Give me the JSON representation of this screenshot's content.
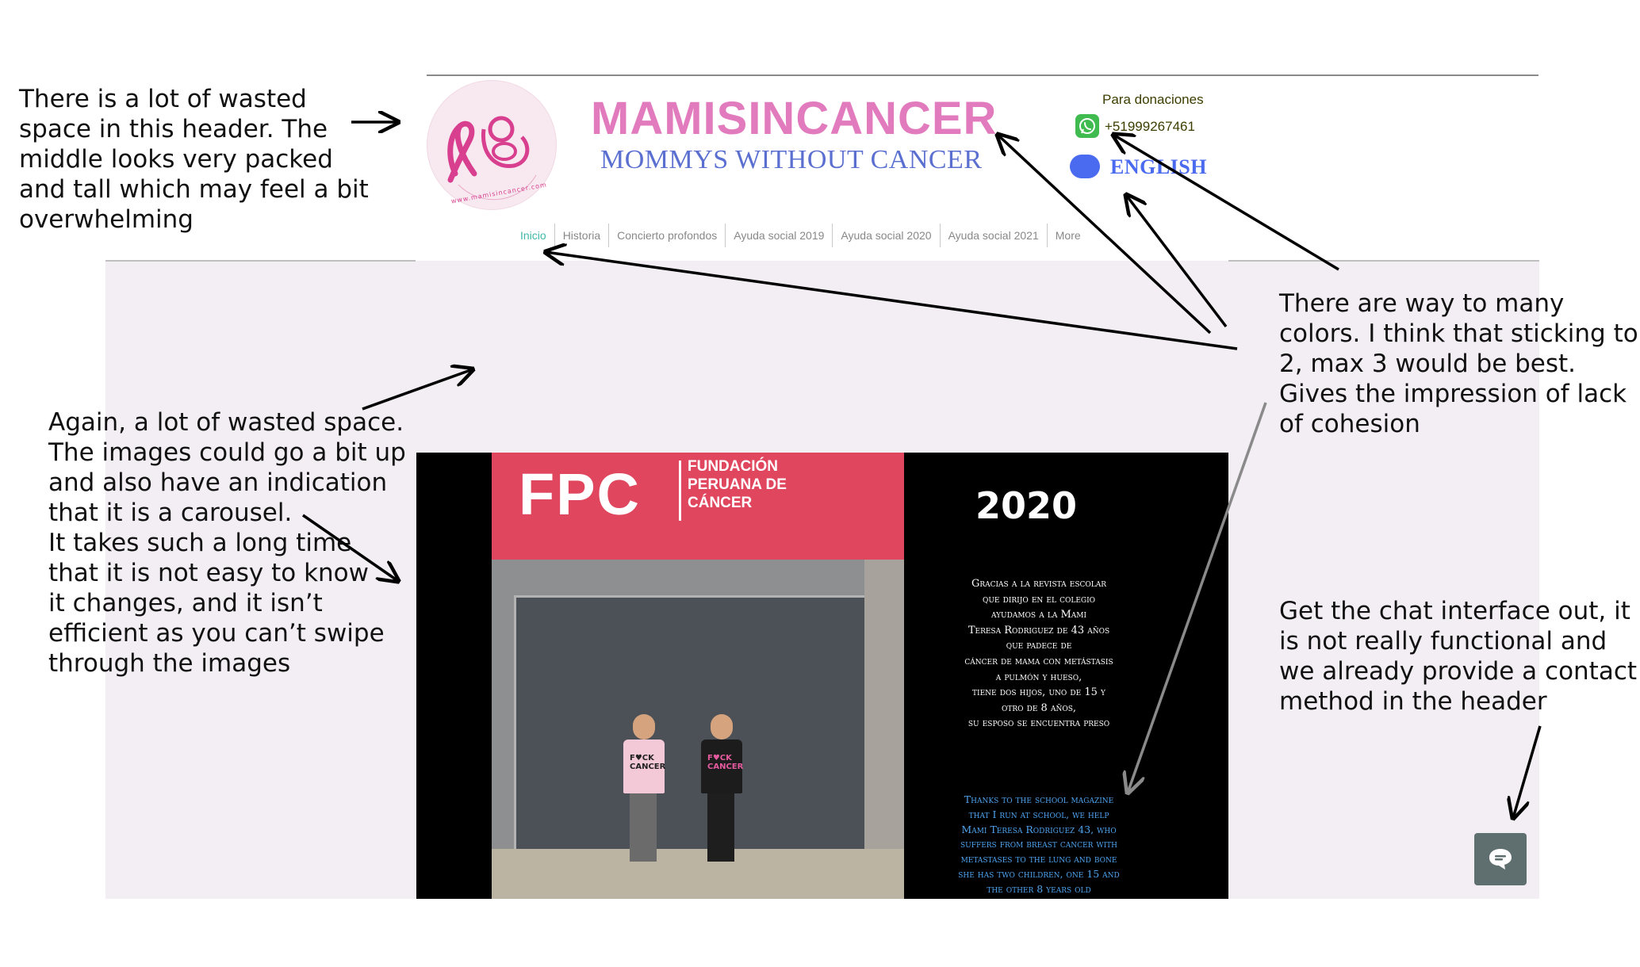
{
  "header": {
    "brand_title": "MAMISINCANCER",
    "brand_subtitle": "MOMMYS WITHOUT CANCER",
    "logo_icon": "pink-ribbon-mother-baby-logo",
    "logo_text": "www.mamisincancer.com",
    "donations_label": "Para donaciones",
    "whatsapp_icon": "whatsapp-icon",
    "phone": "+51999267461",
    "language_label": "ENGLISH"
  },
  "nav": {
    "items": [
      {
        "label": "Inicio"
      },
      {
        "label": "Historia"
      },
      {
        "label": "Concierto profondos"
      },
      {
        "label": "Ayuda social 2019"
      },
      {
        "label": "Ayuda social 2020"
      },
      {
        "label": "Ayuda social 2021"
      },
      {
        "label": "More"
      }
    ]
  },
  "slide": {
    "sign_logo": "FPC",
    "sign_line1": "FUNDACIÓN",
    "sign_line2": "PERUANA DE",
    "sign_line3": "CÁNCER",
    "shirt1": "F♥CK CANCER",
    "shirt2": "F♥CK CANCER",
    "year": "2020",
    "es_lines": [
      "Gracias a la revista escolar",
      "que dirijo  en el colegio",
      "ayudamos a la Mami",
      "Teresa Rodriguez de 43 años",
      "que padece de",
      "cáncer de mama con metástasis",
      "a pulmón y hueso,",
      "tiene dos hijos, uno de 15 y",
      "otro de 8 años,",
      "su esposo se encuentra preso"
    ],
    "en_lines": [
      "Thanks to the school magazine",
      "that I run at school, we help",
      "Mami Teresa Rodriguez 43, who",
      "suffers from breast cancer with",
      "metastases to the lung and bone",
      "she has two children, one 15 and",
      "the other 8 years old"
    ]
  },
  "chat": {
    "icon": "chat-bubble-icon"
  },
  "annotations": {
    "header_note": "There is a lot of wasted\nspace in this header. The\nmiddle looks very packed\nand tall which may feel a bit\noverwhelming",
    "space_note": "Again, a lot of wasted space.\nThe images could go a bit up\nand also have an indication\nthat it is a carousel.\nIt takes such a long time\nthat it is not easy to know\nit changes, and it isn’t\nefficient as you can’t swipe\nthrough the images",
    "color_note": "There are way to many\ncolors. I think that sticking to\n2, max 3 would be best.\nGives the impression of lack\nof cohesion",
    "chat_note": "Get the chat interface out, it\nis not really functional and\nwe already provide a contact\nmethod in the header"
  },
  "colors": {
    "brand_pink": "#e27bbd",
    "subtitle_blue": "#5a6fd0",
    "language_blue": "#4a6af0",
    "nav_active": "#3fb8a8",
    "hero_bg": "#f2eef4",
    "whatsapp_green": "#3fbb4f",
    "english_text_blue": "#4ea3ef",
    "chat_button": "#5f6f6f"
  }
}
